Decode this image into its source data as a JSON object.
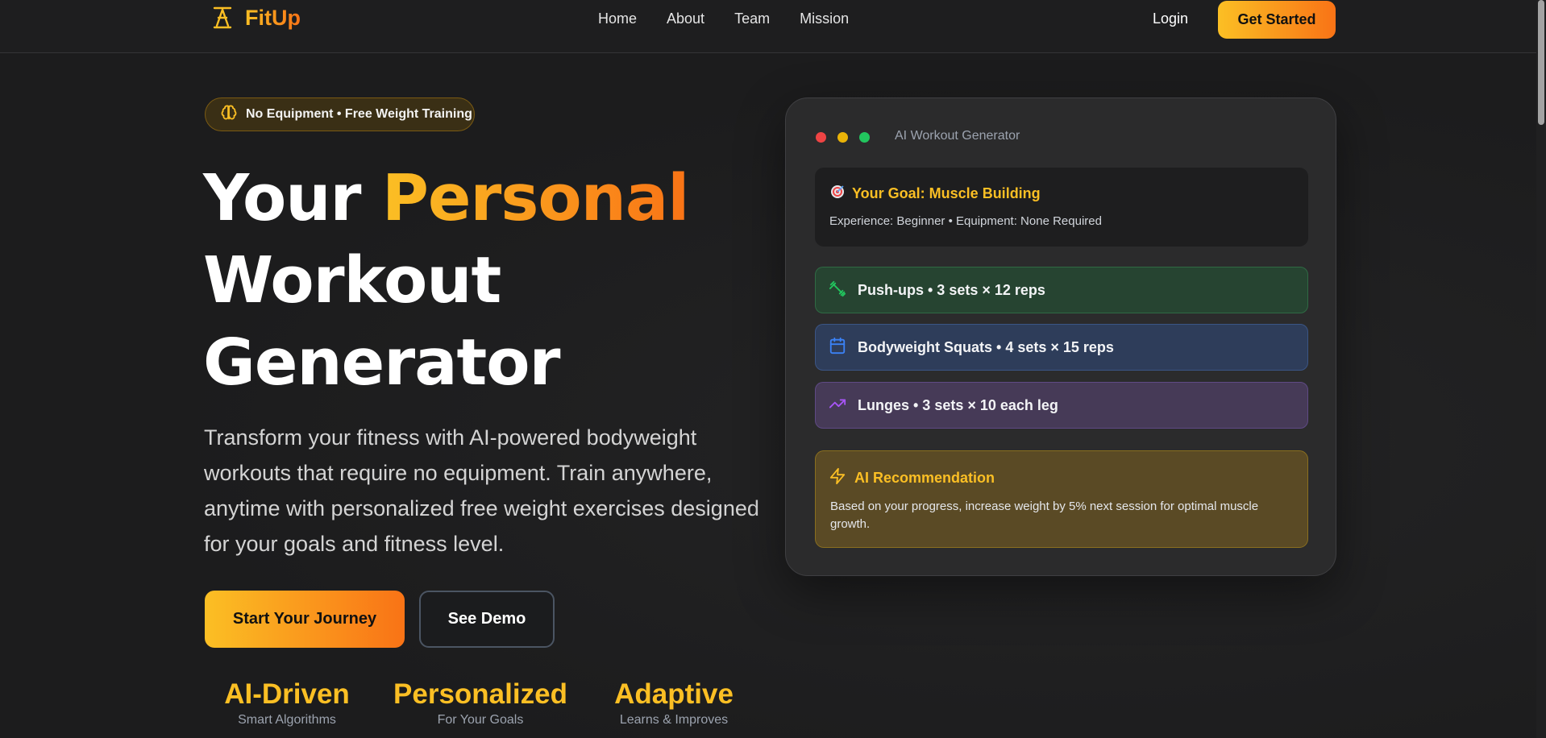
{
  "nav": {
    "brand": "FitUp",
    "links": [
      "Home",
      "About",
      "Team",
      "Mission"
    ],
    "login": "Login",
    "cta": "Get Started"
  },
  "hero": {
    "badge": "No Equipment • Free Weight Training",
    "headline_part1": "Your ",
    "headline_accent": "Personal",
    "headline_line2": "Workout",
    "headline_line3": "Generator",
    "subtext": "Transform your fitness with AI-powered bodyweight workouts that require no equipment. Train anywhere, anytime with personalized free weight exercises designed for your goals and fitness level.",
    "primary_button": "Start Your Journey",
    "secondary_button": "See Demo",
    "stats": [
      {
        "value": "AI-Driven",
        "label": "Smart Algorithms"
      },
      {
        "value": "Personalized",
        "label": "For Your Goals"
      },
      {
        "value": "Adaptive",
        "label": "Learns & Improves"
      }
    ]
  },
  "card": {
    "title": "AI Workout Generator",
    "window_dot_colors": [
      "#ef4444",
      "#eab308",
      "#22c55e"
    ],
    "goal_title": "Your Goal: Muscle Building",
    "goal_sub": "Experience: Beginner • Equipment: None Required",
    "exercises": [
      {
        "label": "Push-ups • 3 sets × 12 reps",
        "icon": "dumbbell-icon",
        "color": "#22c55e"
      },
      {
        "label": "Bodyweight Squats • 4 sets × 15 reps",
        "icon": "calendar-icon",
        "color": "#3b82f6"
      },
      {
        "label": "Lunges • 3 sets × 10 each leg",
        "icon": "trending-up-icon",
        "color": "#a855f7"
      }
    ],
    "recommendation_title": "AI Recommendation",
    "recommendation_text": "Based on your progress, increase weight by 5% next session for optimal muscle growth."
  },
  "colors": {
    "accent_start": "#fbbf24",
    "accent_end": "#f97316",
    "background": "#1c1c1d"
  }
}
